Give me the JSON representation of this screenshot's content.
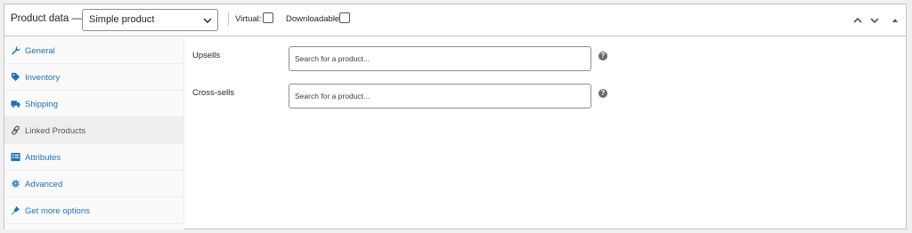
{
  "header": {
    "title": "Product data —",
    "product_type": "Simple product",
    "virtual_label": "Virtual:",
    "downloadable_label": "Downloadable:"
  },
  "tabs": [
    {
      "label": "General",
      "icon": "wrench-icon"
    },
    {
      "label": "Inventory",
      "icon": "tag-icon"
    },
    {
      "label": "Shipping",
      "icon": "truck-icon"
    },
    {
      "label": "Linked Products",
      "icon": "link-icon",
      "active": true
    },
    {
      "label": "Attributes",
      "icon": "list-icon"
    },
    {
      "label": "Advanced",
      "icon": "gear-icon"
    },
    {
      "label": "Get more options",
      "icon": "plugin-icon"
    }
  ],
  "fields": {
    "upsells": {
      "label": "Upsells",
      "placeholder": "Search for a product..."
    },
    "crosssells": {
      "label": "Cross-sells",
      "placeholder": "Search for a product..."
    }
  },
  "colors": {
    "link": "#2271b1",
    "border": "#c3c4c7",
    "active_tab": "#eeeeee"
  }
}
